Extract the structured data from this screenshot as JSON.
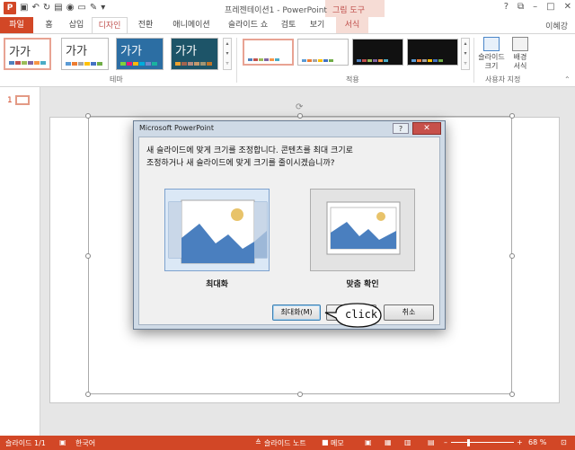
{
  "window": {
    "title": "프레젠테이션1 - PowerPoint",
    "contextual_group": "그림 도구",
    "controls": [
      "?",
      "⧉",
      "–",
      "□",
      "✕"
    ]
  },
  "tabs": {
    "file": "파일",
    "home": "홈",
    "insert": "삽입",
    "design": "디자인",
    "transitions": "전환",
    "animations": "애니메이션",
    "slideshow": "슬라이드 쇼",
    "review": "검토",
    "view": "보기",
    "format": "서식",
    "user": "이혜강"
  },
  "ribbon": {
    "theme_sample": "가가",
    "themes_group": "테마",
    "variants_group": "적용",
    "customize_group": "사용자 지정",
    "slide_size_label": "슬라이드\n크기",
    "background_format_label": "배경\n서식"
  },
  "thumbs": {
    "slide_number": "1"
  },
  "dialog": {
    "title": "Microsoft PowerPoint",
    "help": "?",
    "close": "✕",
    "message_line1": "새 슬라이드에 맞게 크기를 조정합니다. 콘텐츠를 최대 크기로",
    "message_line2": "조정하거나 새 슬라이드에 맞게 크기를 줄이시겠습니까?",
    "option_maximize": "최대화",
    "option_fit": "맞춤 확인",
    "button_maximize": "최대화(M)",
    "button_fit": "맞",
    "button_cancel": "취소"
  },
  "annotation": {
    "callout": "click"
  },
  "status": {
    "slide_indicator": "슬라이드 1/1",
    "language": "한국어",
    "notes": "슬라이드 노트",
    "comments": "메모",
    "zoom_minus": "–",
    "zoom_plus": "+",
    "zoom": "68 %"
  },
  "colors": {
    "accent": "#d24726",
    "dialog_frame": "#cfdae6",
    "selected_option": "#dbe8f6"
  }
}
